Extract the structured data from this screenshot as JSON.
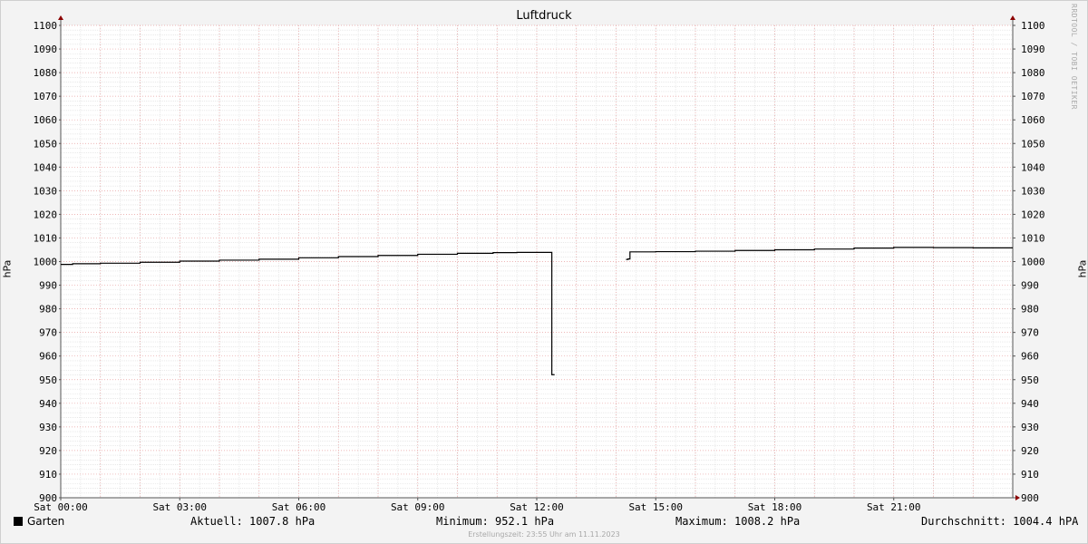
{
  "chart_data": {
    "type": "line",
    "title": "Luftdruck",
    "ylabel": "hPa",
    "ylabel_right": "hPa",
    "xlabel": "",
    "ylim": [
      900,
      1100
    ],
    "xlim_hours": [
      0,
      24
    ],
    "y_ticks": [
      "900",
      "910",
      "920",
      "930",
      "940",
      "950",
      "960",
      "970",
      "980",
      "990",
      "1000",
      "1010",
      "1020",
      "1030",
      "1040",
      "1050",
      "1060",
      "1070",
      "1080",
      "1090",
      "1100"
    ],
    "x_ticks": [
      {
        "hour": 0,
        "label": "Sat 00:00"
      },
      {
        "hour": 3,
        "label": "Sat 03:00"
      },
      {
        "hour": 6,
        "label": "Sat 06:00"
      },
      {
        "hour": 9,
        "label": "Sat 09:00"
      },
      {
        "hour": 12,
        "label": "Sat 12:00"
      },
      {
        "hour": 15,
        "label": "Sat 15:00"
      },
      {
        "hour": 18,
        "label": "Sat 18:00"
      },
      {
        "hour": 21,
        "label": "Sat 21:00"
      }
    ],
    "grid": true,
    "series": [
      {
        "name": "Garten",
        "color": "#000000",
        "segments": [
          [
            [
              0.0,
              998.8
            ],
            [
              0.3,
              999.1
            ],
            [
              1.0,
              999.3
            ],
            [
              2.0,
              999.7
            ],
            [
              3.0,
              1000.2
            ],
            [
              4.0,
              1000.6
            ],
            [
              5.0,
              1001.0
            ],
            [
              6.0,
              1001.6
            ],
            [
              7.0,
              1002.1
            ],
            [
              8.0,
              1002.6
            ],
            [
              9.0,
              1003.1
            ],
            [
              10.0,
              1003.5
            ],
            [
              10.9,
              1003.8
            ],
            [
              11.5,
              1003.9
            ],
            [
              12.0,
              1003.9
            ],
            [
              12.35,
              1003.9
            ],
            [
              12.38,
              952.1
            ],
            [
              12.45,
              952.1
            ]
          ],
          [
            [
              14.25,
              1000.9
            ],
            [
              14.3,
              1001.1
            ],
            [
              14.35,
              1004.1
            ],
            [
              15.0,
              1004.2
            ],
            [
              16.0,
              1004.4
            ],
            [
              17.0,
              1004.7
            ],
            [
              18.0,
              1005.0
            ],
            [
              19.0,
              1005.3
            ],
            [
              20.0,
              1005.7
            ],
            [
              21.0,
              1006.0
            ],
            [
              22.0,
              1005.9
            ],
            [
              23.0,
              1005.8
            ],
            [
              24.0,
              1005.8
            ]
          ]
        ]
      }
    ]
  },
  "watermark": "RRDTOOL / TOBI OETIKER",
  "legend": {
    "name": "Garten",
    "color": "#000000",
    "current": "Aktuell: 1007.8 hPa",
    "minimum": "Minimum: 952.1 hPa",
    "maximum": "Maximum: 1008.2 hPa",
    "average": "Durchschnitt: 1004.4 hPA"
  },
  "footer": "Erstellungszeit: 23:55 Uhr am 11.11.2023"
}
